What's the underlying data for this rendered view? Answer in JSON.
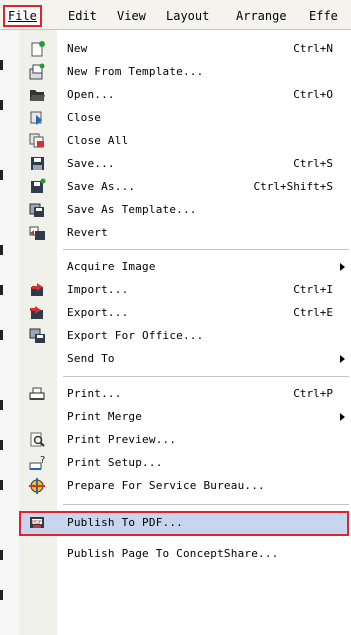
{
  "menubar": {
    "items": [
      {
        "label": "File",
        "active": true
      },
      {
        "label": "Edit"
      },
      {
        "label": "View"
      },
      {
        "label": "Layout"
      },
      {
        "label": "Arrange"
      },
      {
        "label": "Effe"
      }
    ]
  },
  "file_menu": {
    "items": [
      {
        "label": "New",
        "shortcut": "Ctrl+N",
        "icon": "new-document-icon"
      },
      {
        "label": "New From Template...",
        "shortcut": "",
        "icon": "new-from-template-icon"
      },
      {
        "label": "Open...",
        "shortcut": "Ctrl+O",
        "icon": "open-folder-icon"
      },
      {
        "label": "Close",
        "shortcut": "",
        "icon": "close-document-icon"
      },
      {
        "label": "Close All",
        "shortcut": "",
        "icon": "close-all-icon"
      },
      {
        "label": "Save...",
        "shortcut": "Ctrl+S",
        "icon": "save-icon"
      },
      {
        "label": "Save As...",
        "shortcut": "Ctrl+Shift+S",
        "icon": "save-as-icon"
      },
      {
        "label": "Save As Template...",
        "shortcut": "",
        "icon": "save-as-template-icon"
      },
      {
        "label": "Revert",
        "shortcut": "",
        "icon": "revert-icon"
      },
      {
        "label": "Acquire Image",
        "shortcut": "",
        "icon": ""
      },
      {
        "label": "Import...",
        "shortcut": "Ctrl+I",
        "icon": "import-icon"
      },
      {
        "label": "Export...",
        "shortcut": "Ctrl+E",
        "icon": "export-icon"
      },
      {
        "label": "Export For Office...",
        "shortcut": "",
        "icon": "export-for-office-icon"
      },
      {
        "label": "Send To",
        "shortcut": "",
        "icon": ""
      },
      {
        "label": "Print...",
        "shortcut": "Ctrl+P",
        "icon": "printer-icon"
      },
      {
        "label": "Print Merge",
        "shortcut": "",
        "icon": ""
      },
      {
        "label": "Print Preview...",
        "shortcut": "",
        "icon": "print-preview-icon"
      },
      {
        "label": "Print Setup...",
        "shortcut": "",
        "icon": "print-setup-icon"
      },
      {
        "label": "Prepare For Service Bureau...",
        "shortcut": "",
        "icon": "service-bureau-icon"
      },
      {
        "label": "Publish To PDF...",
        "shortcut": "",
        "icon": "pdf-icon"
      },
      {
        "label": "Publish Page To ConceptShare...",
        "shortcut": "",
        "icon": ""
      }
    ]
  },
  "colors": {
    "highlight": "#c7d6ee",
    "annotation_border": "#e0232e"
  }
}
